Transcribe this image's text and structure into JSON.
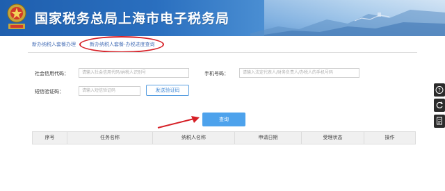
{
  "header": {
    "title": "国家税务总局上海市电子税务局"
  },
  "breadcrumb": {
    "item1": "新办纳税人套餐办理",
    "item2": "新办纳税人套餐-办税进度查询"
  },
  "form": {
    "credit_code_label": "社会信用代码：",
    "credit_code_placeholder": "请输入社会信用代码/纳税人识别号",
    "phone_label": "手机号码：",
    "phone_placeholder": "请输入法定代表人/财务负责人/办税人的手机号码",
    "sms_label": "短信验证码：",
    "sms_placeholder": "请输入短信验证码",
    "send_code_label": "发送验证码",
    "query_label": "查询"
  },
  "table": {
    "columns": [
      "序号",
      "任务名称",
      "纳税人名称",
      "申请日期",
      "受理状态",
      "操作"
    ]
  },
  "colors": {
    "brand_blue": "#2a6fbf",
    "button_blue": "#4da2ec",
    "annotation_red": "#d61f26"
  },
  "side_tools": [
    "help-icon",
    "refresh-icon",
    "document-icon"
  ]
}
